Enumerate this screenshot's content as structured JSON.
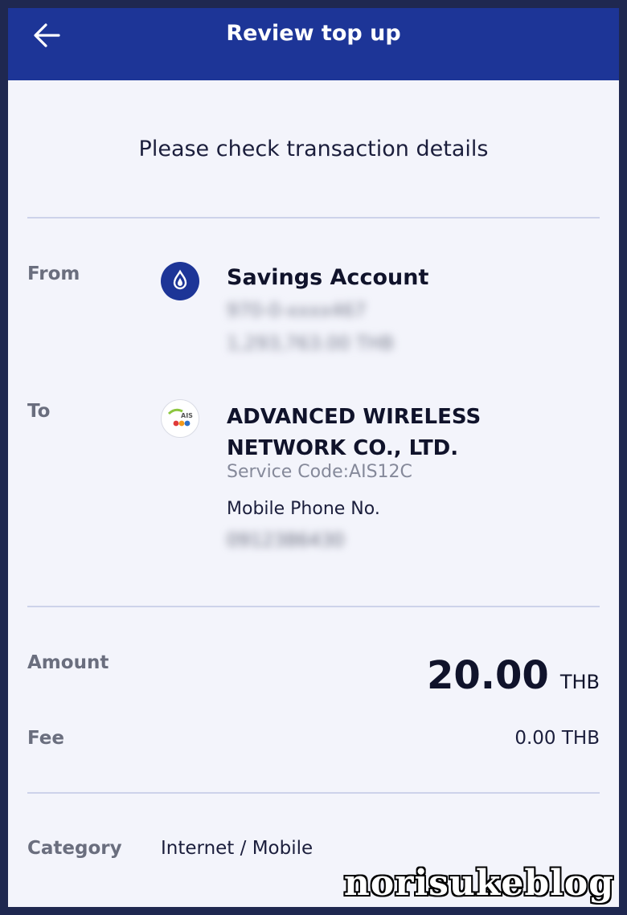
{
  "header": {
    "title": "Review top up",
    "back_icon": "arrow-left-icon"
  },
  "subtitle": "Please check transaction details",
  "from": {
    "label": "From",
    "icon": "bank-logo-icon",
    "account_name": "Savings Account",
    "account_number": "970-0-xxxx467",
    "balance": "1,293,763.00 THB"
  },
  "to": {
    "label": "To",
    "icon": "ais-logo-icon",
    "payee": "ADVANCED WIRELESS NETWORK CO., LTD.",
    "service_code": "Service Code:AIS12C",
    "mobile_label": "Mobile Phone No.",
    "mobile_number": "0912386430"
  },
  "amount": {
    "label": "Amount",
    "value": "20.00",
    "currency": "THB"
  },
  "fee": {
    "label": "Fee",
    "value": "0.00 THB"
  },
  "category": {
    "label": "Category",
    "value": "Internet / Mobile"
  },
  "watermark": "norisukeblog",
  "colors": {
    "header": "#1d3597",
    "background": "#f3f4fb",
    "divider": "#cdd2ea"
  }
}
